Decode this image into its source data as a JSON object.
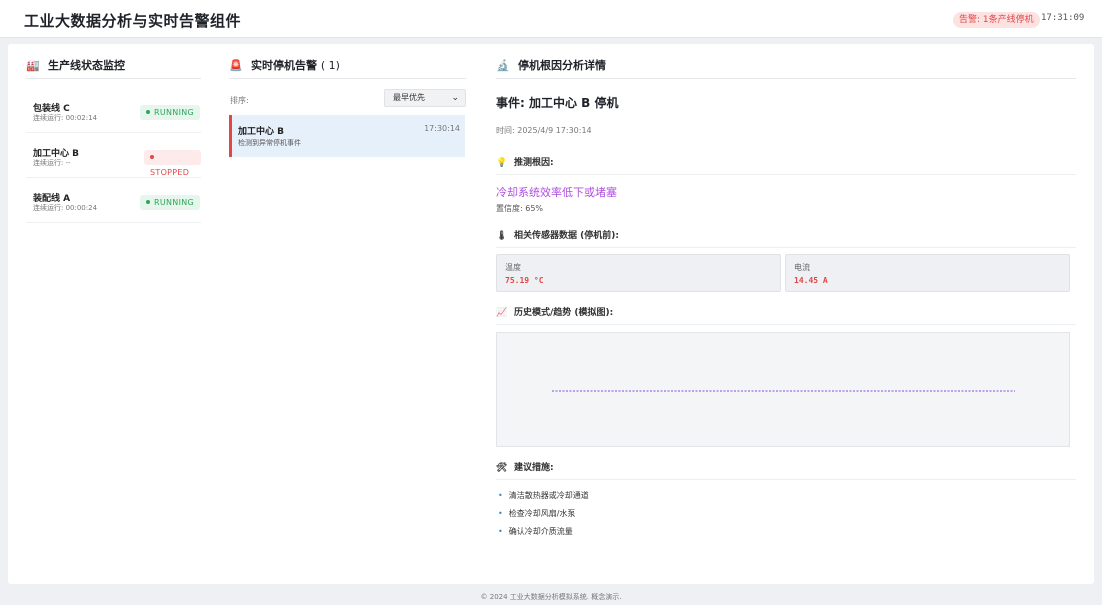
{
  "header": {
    "title": "工业大数据分析与实时告警组件",
    "alert_badge": "告警: 1条产线停机",
    "clock": "17:31:09"
  },
  "colors": {
    "running": "#2ea55a",
    "stopped": "#e04848",
    "accent_cause": "#b04fe0",
    "selected_bg": "#e6f0fb",
    "chart_line": "#9c6ee0"
  },
  "lines_panel": {
    "title": "生产线状态监控",
    "icon": "factory-icon",
    "items": [
      {
        "name": "包装线 C",
        "runtime": "连续运行: 00:02:14",
        "status": "RUNNING",
        "state": "run"
      },
      {
        "name": "加工中心 B",
        "runtime": "连续运行: --",
        "status": "STOPPED",
        "state": "stop"
      },
      {
        "name": "装配线 A",
        "runtime": "连续运行: 00:00:24",
        "status": "RUNNING",
        "state": "run"
      }
    ]
  },
  "alerts_panel": {
    "title": "实时停机告警",
    "count": "( 1)",
    "icon": "siren-icon",
    "sort_label": "排序:",
    "sort_value": "最早优先",
    "items": [
      {
        "name": "加工中心 B",
        "desc": "检测到异常停机事件",
        "time": "17:30:14"
      }
    ]
  },
  "detail_panel": {
    "title": "停机根因分析详情",
    "icon": "microscope-icon",
    "event_title": "事件: 加工中心 B 停机",
    "event_time": "时间: 2025/4/9 17:30:14",
    "cause_head": "推测根因:",
    "cause": "冷却系统效率低下或堵塞",
    "confidence": "置信度: 65%",
    "sensor_head": "相关传感器数据 (停机前):",
    "sensors": [
      {
        "label": "温度",
        "value": "75.19 °C"
      },
      {
        "label": "电流",
        "value": "14.45 A"
      }
    ],
    "history_head": "历史模式/趋势 (模拟图):",
    "suggest_head": "建议措施:",
    "suggestions": [
      "清洁散热器或冷却通道",
      "检查冷却风扇/水泵",
      "确认冷却介质流量"
    ]
  },
  "footer": {
    "text": "© 2024 工业大数据分析模拟系统. 概念演示."
  }
}
